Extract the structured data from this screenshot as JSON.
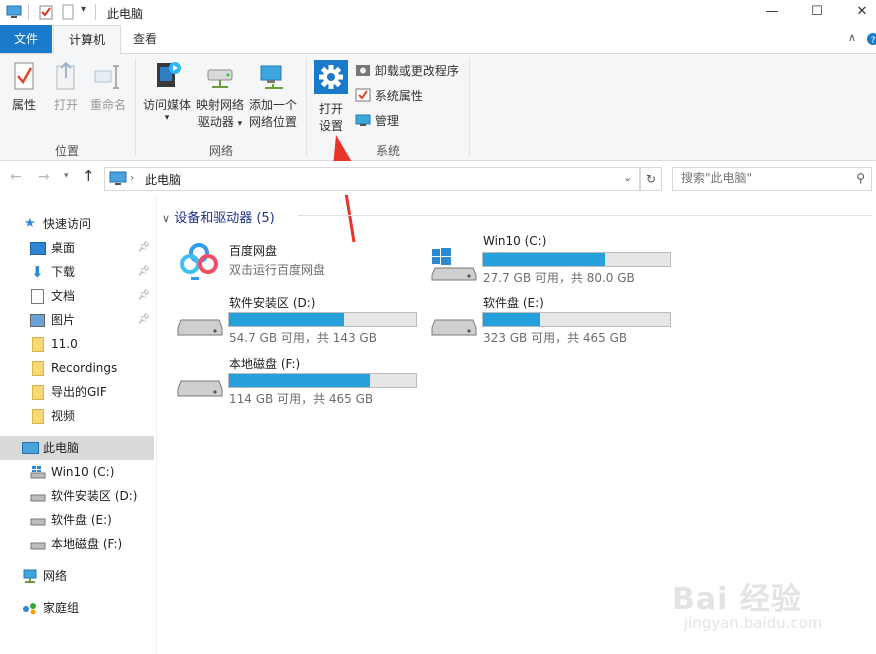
{
  "window": {
    "title": "此电脑"
  },
  "window_controls": {
    "minimize": "—",
    "maximize": "☐",
    "close": "✕"
  },
  "tabs": {
    "file": "文件",
    "computer": "计算机",
    "view": "查看"
  },
  "ribbon": {
    "location": {
      "properties": "属性",
      "open": "打开",
      "rename": "重命名",
      "group": "位置"
    },
    "network": {
      "media_line1": "访问媒体",
      "map_line1": "映射网络",
      "map_line2": "驱动器",
      "add_line1": "添加一个",
      "add_line2": "网络位置",
      "group": "网络"
    },
    "system": {
      "open_settings_line1": "打开",
      "open_settings_line2": "设置",
      "uninstall": "卸载或更改程序",
      "sys_props": "系统属性",
      "manage": "管理",
      "group": "系统"
    }
  },
  "address": {
    "current": "此电脑",
    "search_placeholder": "搜索\"此电脑\""
  },
  "nav": {
    "quick_access": "快速访问",
    "desktop": "桌面",
    "downloads": "下载",
    "documents": "文档",
    "pictures": "图片",
    "f1": "11.0",
    "f2": "Recordings",
    "f3": "导出的GIF",
    "f4": "视频",
    "this_pc": "此电脑",
    "c": "Win10 (C:)",
    "d": "软件安装区 (D:)",
    "e": "软件盘 (E:)",
    "f": "本地磁盘 (F:)",
    "network": "网络",
    "homegroup": "家庭组"
  },
  "main": {
    "section_title": "设备和驱动器 (5)",
    "baidu": {
      "name": "百度网盘",
      "desc": "双击运行百度网盘"
    },
    "drives": [
      {
        "name": "Win10 (C:)",
        "size": "27.7 GB 可用，共 80.0 GB",
        "used": 0.654
      },
      {
        "name": "软件安装区 (D:)",
        "size": "54.7 GB 可用，共 143 GB",
        "used": 0.617
      },
      {
        "name": "软件盘 (E:)",
        "size": "323 GB 可用，共 465 GB",
        "used": 0.305
      },
      {
        "name": "本地磁盘 (F:)",
        "size": "114 GB 可用，共 465 GB",
        "used": 0.755
      }
    ]
  },
  "watermark": {
    "brand": "Bai 经验",
    "url": "jingyan.baidu.com"
  }
}
